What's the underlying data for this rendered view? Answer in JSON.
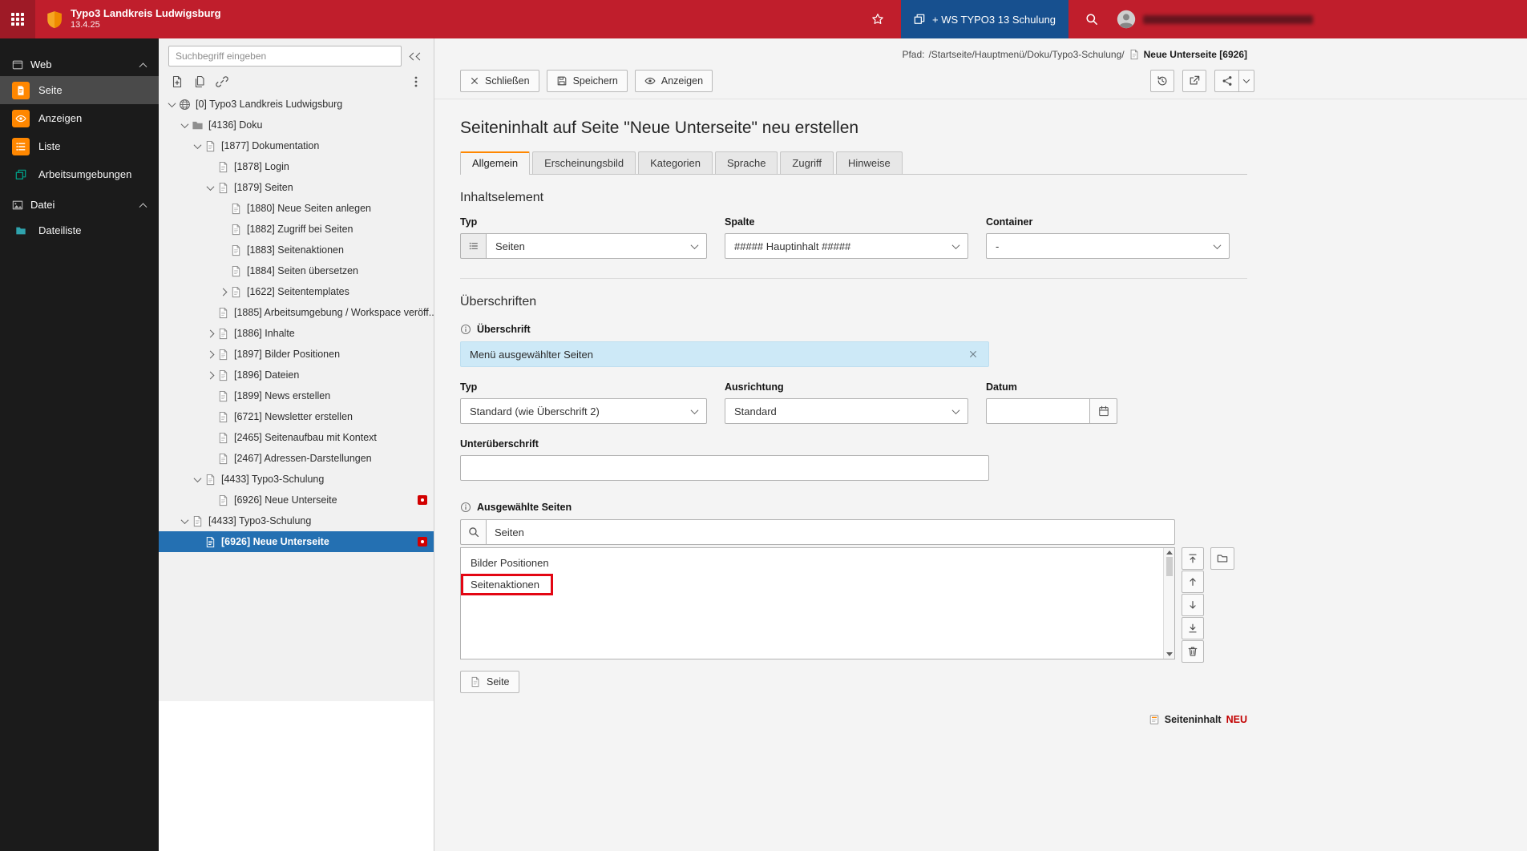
{
  "colors": {
    "c-topbar": "#c01e2c",
    "c-topbar-dark": "#9e1a26",
    "c-ws-blue": "#17508f",
    "c-orange": "#ff8700",
    "c-select-blue": "#2470b2",
    "c-badge-red": "#d20000",
    "c-annotation": "#e30613",
    "c-new-red": "#c20000"
  },
  "topbar": {
    "title": "Typo3 Landkreis Ludwigsburg",
    "version": "13.4.25",
    "workspace_button_label": "+ WS TYPO3 13 Schulung"
  },
  "module_menu": {
    "sections": [
      {
        "label": "Web",
        "icon": "window",
        "items": [
          {
            "label": "Seite",
            "icon": "pagew",
            "color": "#ff8700",
            "active": true
          },
          {
            "label": "Anzeigen",
            "icon": "eye",
            "color": "#ff8700",
            "active": false
          },
          {
            "label": "Liste",
            "icon": "list",
            "color": "#ff8700",
            "active": false
          },
          {
            "label": "Arbeitsumgebungen",
            "icon": "cube",
            "color": "#00a28a",
            "active": false
          }
        ]
      },
      {
        "label": "Datei",
        "icon": "image",
        "items": [
          {
            "label": "Dateiliste",
            "icon": "folderfill",
            "color": "#2fa3ad",
            "active": false
          }
        ]
      }
    ]
  },
  "pagetree": {
    "search_placeholder": "Suchbegriff eingeben",
    "nodes": [
      {
        "label": "[0] Typo3 Landkreis Ludwigsburg",
        "depth": 0,
        "toggle": "expanded",
        "icon": "globe"
      },
      {
        "label": "[4136] Doku",
        "depth": 1,
        "toggle": "expanded",
        "icon": "folder"
      },
      {
        "label": "[1877] Dokumentation",
        "depth": 2,
        "toggle": "expanded",
        "icon": "page"
      },
      {
        "label": "[1878] Login",
        "depth": 3,
        "toggle": "none",
        "icon": "page"
      },
      {
        "label": "[1879] Seiten",
        "depth": 3,
        "toggle": "expanded",
        "icon": "page"
      },
      {
        "label": "[1880] Neue Seiten anlegen",
        "depth": 4,
        "toggle": "none",
        "icon": "page"
      },
      {
        "label": "[1882] Zugriff bei Seiten",
        "depth": 4,
        "toggle": "none",
        "icon": "page"
      },
      {
        "label": "[1883] Seitenaktionen",
        "depth": 4,
        "toggle": "none",
        "icon": "page"
      },
      {
        "label": "[1884] Seiten übersetzen",
        "depth": 4,
        "toggle": "none",
        "icon": "page"
      },
      {
        "label": "[1622] Seitentemplates",
        "depth": 4,
        "toggle": "collapsed",
        "icon": "page"
      },
      {
        "label": "[1885] Arbeitsumgebung / Workspace veröff...",
        "depth": 3,
        "toggle": "none",
        "icon": "page"
      },
      {
        "label": "[1886] Inhalte",
        "depth": 3,
        "toggle": "collapsed",
        "icon": "page"
      },
      {
        "label": "[1897] Bilder Positionen",
        "depth": 3,
        "toggle": "collapsed",
        "icon": "page"
      },
      {
        "label": "[1896] Dateien",
        "depth": 3,
        "toggle": "collapsed",
        "icon": "page"
      },
      {
        "label": "[1899] News erstellen",
        "depth": 3,
        "toggle": "none",
        "icon": "page"
      },
      {
        "label": "[6721] Newsletter erstellen",
        "depth": 3,
        "toggle": "none",
        "icon": "page"
      },
      {
        "label": "[2465] Seitenaufbau mit Kontext",
        "depth": 3,
        "toggle": "none",
        "icon": "page"
      },
      {
        "label": "[2467] Adressen-Darstellungen",
        "depth": 3,
        "toggle": "none",
        "icon": "page"
      },
      {
        "label": "[4433] Typo3-Schulung",
        "depth": 2,
        "toggle": "expanded",
        "icon": "page"
      },
      {
        "label": "[6926] Neue Unterseite",
        "depth": 3,
        "toggle": "none",
        "icon": "page",
        "badge": true
      },
      {
        "label": "[4433] Typo3-Schulung",
        "depth": 1,
        "toggle": "expanded",
        "icon": "page"
      },
      {
        "label": "[6926] Neue Unterseite",
        "depth": 2,
        "toggle": "none",
        "icon": "page",
        "badge": true,
        "selected": true
      }
    ]
  },
  "docheader": {
    "path_label": "Pfad:",
    "path_value": "/Startseite/Hauptmenü/Doku/Typo3-Schulung/",
    "record_title": "Neue Unterseite [6926]",
    "close_label": "Schließen",
    "save_label": "Speichern",
    "view_label": "Anzeigen"
  },
  "form": {
    "heading": "Seiteninhalt auf Seite \"Neue Unterseite\" neu erstellen",
    "tabs": [
      {
        "label": "Allgemein",
        "active": true
      },
      {
        "label": "Erscheinungsbild",
        "active": false
      },
      {
        "label": "Kategorien",
        "active": false
      },
      {
        "label": "Sprache",
        "active": false
      },
      {
        "label": "Zugriff",
        "active": false
      },
      {
        "label": "Hinweise",
        "active": false
      }
    ],
    "content_element": {
      "heading": "Inhaltselement",
      "type_label": "Typ",
      "type_value": "Seiten",
      "column_label": "Spalte",
      "column_value": "##### Hauptinhalt #####",
      "container_label": "Container",
      "container_value": "-"
    },
    "headlines": {
      "heading": "Überschriften",
      "headline_label": "Überschrift",
      "headline_value": "Menü ausgewählter Seiten",
      "type_label": "Typ",
      "type_value": "Standard (wie Überschrift 2)",
      "alignment_label": "Ausrichtung",
      "alignment_value": "Standard",
      "date_label": "Datum",
      "subheadline_label": "Unterüberschrift"
    },
    "selected_pages": {
      "label": "Ausgewählte Seiten",
      "search_value": "Seiten",
      "items": [
        "Bilder Positionen",
        "Seitenaktionen"
      ],
      "highlighted_item": "Seitenaktionen",
      "add_page_label": "Seite"
    },
    "footer": {
      "record_label": "Seiteninhalt",
      "state_label": "NEU"
    }
  }
}
